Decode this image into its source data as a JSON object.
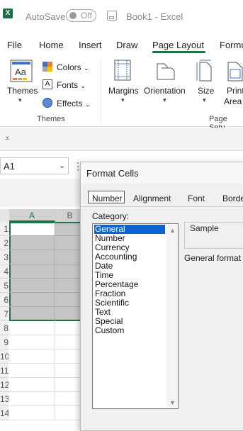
{
  "titlebar": {
    "autosave_label": "AutoSave",
    "autosave_state": "Off",
    "window_title": "Book1  -  Excel",
    "logo_letter": "X"
  },
  "tabs": [
    "File",
    "Home",
    "Insert",
    "Draw",
    "Page Layout",
    "Formu"
  ],
  "active_tab": "Page Layout",
  "ribbon": {
    "themes": {
      "label": "Themes",
      "chevron": "⌄"
    },
    "colors": "Colors",
    "fonts": "Fonts",
    "effects": "Effects",
    "themes_group": "Themes",
    "margins": "Margins",
    "orientation": "Orientation",
    "size": "Size",
    "print_area_1": "Print",
    "print_area_2": "Area",
    "page_setup_group": "Page Setu"
  },
  "namebox": {
    "value": "A1"
  },
  "grid": {
    "columns": [
      "A",
      "B"
    ],
    "rows": [
      "1",
      "2",
      "3",
      "4",
      "5",
      "6",
      "7",
      "8",
      "9",
      "10",
      "11",
      "12",
      "13",
      "14"
    ]
  },
  "dialog": {
    "title": "Format Cells",
    "tabs": [
      "Number",
      "Alignment",
      "Font",
      "Borde"
    ],
    "category_label": "Category:",
    "categories": [
      "General",
      "Number",
      "Currency",
      "Accounting",
      "Date",
      "Time",
      "Percentage",
      "Fraction",
      "Scientific",
      "Text",
      "Special",
      "Custom"
    ],
    "selected_category": "General",
    "sample_label": "Sample",
    "general_note": "General format c"
  },
  "colors": {
    "accent": "#217346",
    "selection": "#0a64d2"
  }
}
